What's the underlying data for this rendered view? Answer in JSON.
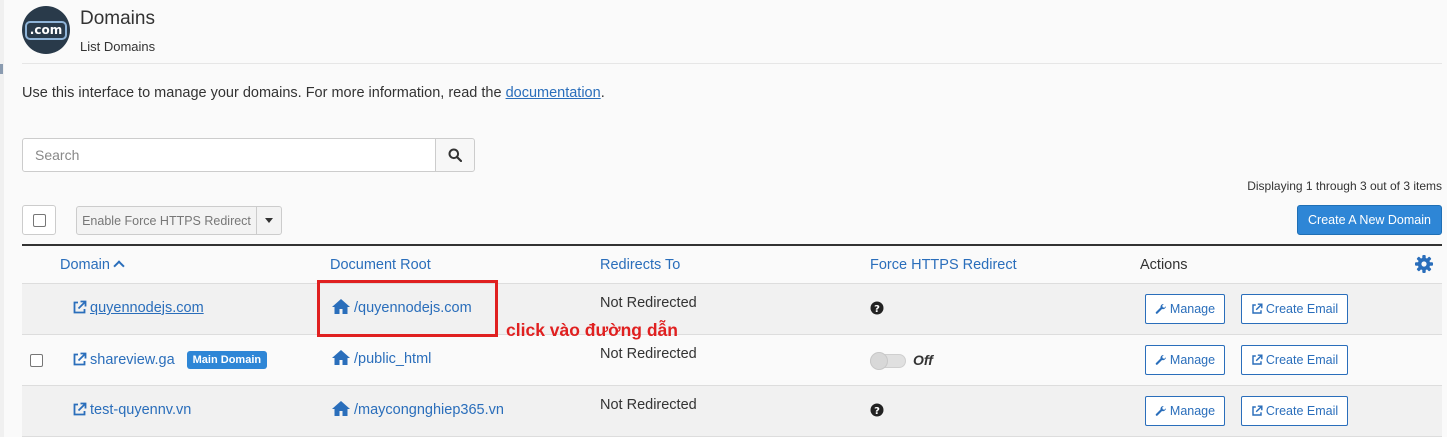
{
  "header": {
    "logo_text": ".com",
    "title": "Domains",
    "subtitle": "List Domains"
  },
  "intro": {
    "text": "Use this interface to manage your domains. For more information, read the ",
    "link": "documentation",
    "suffix": "."
  },
  "search": {
    "placeholder": "Search",
    "value": ""
  },
  "displaying": "Displaying 1 through 3 out of 3 items",
  "toolbar": {
    "https_button": "Enable Force HTTPS Redirect",
    "create_button": "Create A New Domain"
  },
  "table": {
    "columns": {
      "domain": "Domain",
      "document_root": "Document Root",
      "redirects_to": "Redirects To",
      "force_https": "Force HTTPS Redirect",
      "actions": "Actions"
    },
    "rows": [
      {
        "domain": "quyennodejs.com",
        "document_root": "/quyennodejs.com",
        "redirects_to": "Not Redirected",
        "https_status": "help",
        "manage": "Manage",
        "create_email": "Create Email"
      },
      {
        "domain": "shareview.ga",
        "badge": "Main Domain",
        "document_root": "/public_html",
        "redirects_to": "Not Redirected",
        "https_toggle": "Off",
        "manage": "Manage",
        "create_email": "Create Email"
      },
      {
        "domain": "test-quyennv.vn",
        "document_root": "/maycongnghiep365.vn",
        "redirects_to": "Not Redirected",
        "https_status": "help",
        "manage": "Manage",
        "create_email": "Create Email"
      }
    ]
  },
  "annotation": "click vào đường dẫn",
  "colors": {
    "accent": "#2a6ebb",
    "primary_button": "#2e86d6",
    "annotation": "#e02020",
    "logo_bg": "#293a4a"
  }
}
